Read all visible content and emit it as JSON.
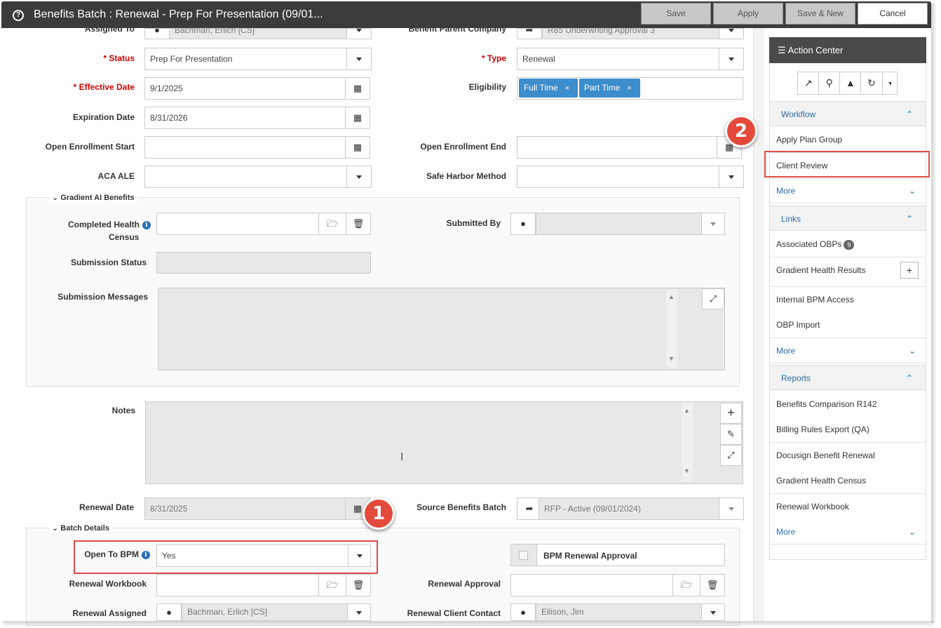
{
  "window": {
    "title": "Benefits Batch : Renewal - Prep For Presentation (09/01...",
    "buttons": {
      "save": "Save",
      "apply": "Apply",
      "save_new": "Save & New",
      "cancel": "Cancel"
    }
  },
  "form": {
    "assigned_to": {
      "label": "Assigned To",
      "value": "Bachman, Erlich [CS]"
    },
    "benefit_parent_company": {
      "label": "Benefit Parent Company",
      "value": "R85 Underwriting Approval 3"
    },
    "status": {
      "label": "* Status",
      "value": "Prep For Presentation"
    },
    "type": {
      "label": "* Type",
      "value": "Renewal"
    },
    "effective_date": {
      "label": "* Effective Date",
      "value": "9/1/2025"
    },
    "eligibility": {
      "label": "Eligibility",
      "tags": [
        "Full Time",
        "Part Time"
      ],
      "remove_glyph": "×"
    },
    "expiration_date": {
      "label": "Expiration Date",
      "value": "8/31/2026"
    },
    "open_enrollment_start": {
      "label": "Open Enrollment Start",
      "value": ""
    },
    "open_enrollment_end": {
      "label": "Open Enrollment End",
      "value": ""
    },
    "aca_ale": {
      "label": "ACA ALE",
      "value": ""
    },
    "safe_harbor_method": {
      "label": "Safe Harbor Method",
      "value": ""
    },
    "gradient_section": {
      "title": "Gradient AI Benefits",
      "completed_health_census": {
        "label_line1": "Completed Health",
        "label_line2": "Census",
        "value": ""
      },
      "submitted_by": {
        "label": "Submitted By",
        "value": ""
      },
      "submission_status": {
        "label": "Submission Status",
        "value": ""
      },
      "submission_messages": {
        "label": "Submission Messages",
        "value": ""
      }
    },
    "notes": {
      "label": "Notes",
      "value": ""
    },
    "renewal_date": {
      "label": "Renewal Date",
      "value": "8/31/2025"
    },
    "source_benefits_batch": {
      "label": "Source Benefits Batch",
      "value": "RFP - Active (09/01/2024)"
    },
    "batch_details": {
      "title": "Batch Details",
      "open_to_bpm": {
        "label": "Open To BPM",
        "value": "Yes"
      },
      "bpm_renewal_approval": {
        "label": "BPM Renewal Approval",
        "checked": false
      },
      "renewal_workbook": {
        "label": "Renewal Workbook",
        "value": ""
      },
      "renewal_approval": {
        "label": "Renewal Approval",
        "value": ""
      },
      "renewal_assigned": {
        "label": "Renewal Assigned",
        "value": "Bachman, Erlich [CS]"
      },
      "renewal_client_contact": {
        "label": "Renewal Client Contact",
        "value": "Ellison, Jim"
      }
    }
  },
  "action_center": {
    "title": "Action Center",
    "workflow": {
      "title": "Workflow",
      "items": [
        "Apply Plan Group",
        "Client Review"
      ],
      "more": "More"
    },
    "links": {
      "title": "Links",
      "items": [
        "Associated OBPs",
        "Gradient Health Results",
        "Internal BPM Access",
        "OBP Import"
      ],
      "obp_count": "9",
      "more": "More"
    },
    "reports": {
      "title": "Reports",
      "items": [
        "Benefits Comparison R142",
        "Billing Rules Export (QA)",
        "Docusign Benefit Renewal",
        "Gradient Health Census",
        "Renewal Workbook"
      ],
      "more": "More"
    }
  },
  "callouts": {
    "one": "1",
    "two": "2"
  },
  "colors": {
    "title_bar": "#3b3b3b",
    "tag_blue": "#3c8dcb",
    "required_red": "#cc0000",
    "highlight_red": "#e04b4b",
    "link_blue": "#2e6da4"
  }
}
